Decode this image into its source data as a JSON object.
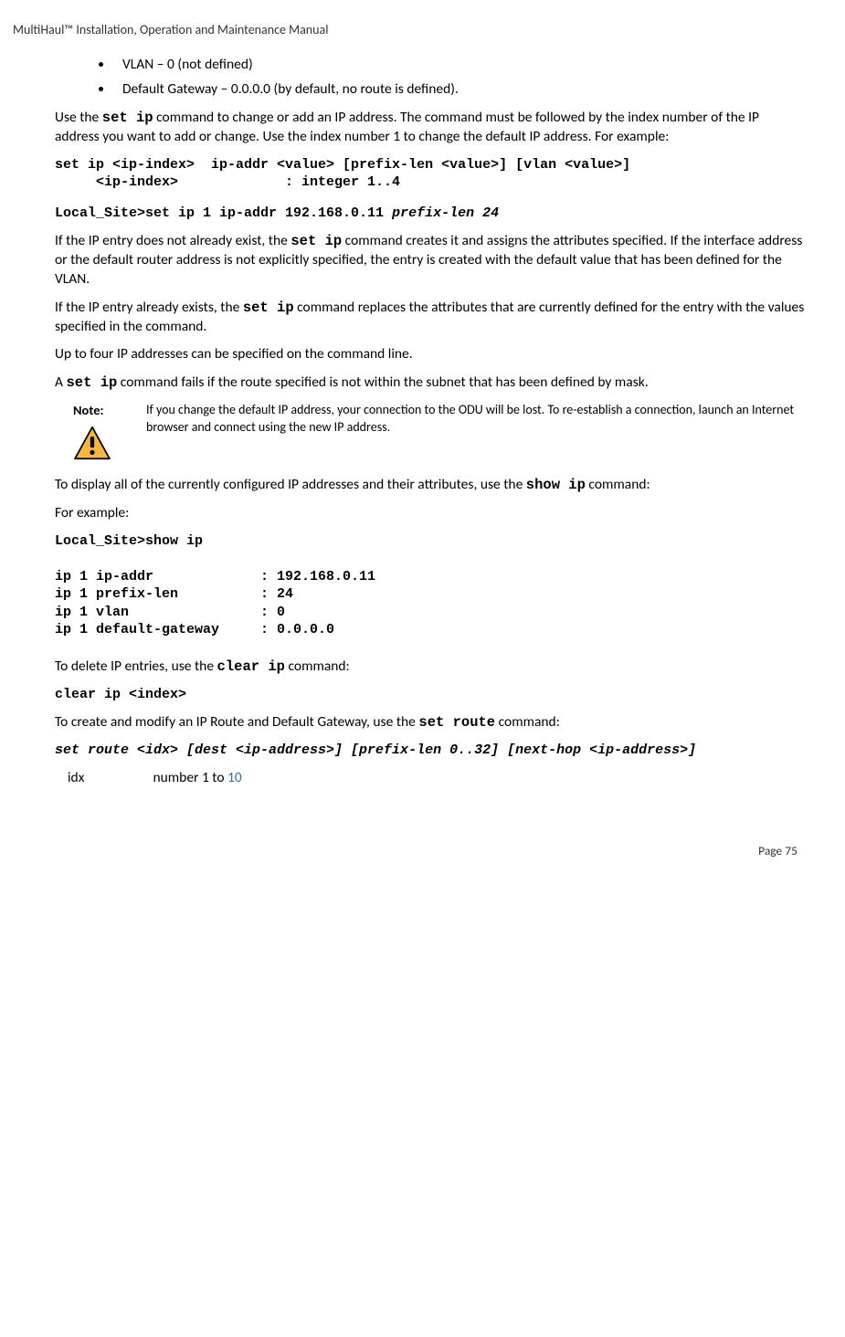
{
  "header": "MultiHaul™ Installation, Operation and Maintenance Manual",
  "bullets": [
    "VLAN – 0 (not defined)",
    "Default Gateway – 0.0.0.0 (by default, no route is defined)."
  ],
  "para1_pre": "Use the ",
  "para1_code": "set ip",
  "para1_post": " command to change or add an IP address. The command must be followed by the index number of the IP address you want to add or change. Use the index number 1 to change the default IP address. For example:",
  "codeblock1": "set ip <ip-index>  ip-addr <value> [prefix-len <value>] [vlan <value>]\n     <ip-index>             : integer 1..4",
  "codeblock2_plain": "Local_Site>set ip 1 ip-addr 192.168.0.11 ",
  "codeblock2_italic": "prefix-len 24",
  "para2_pre": "If the IP entry does not already exist, the ",
  "para2_code": "set ip",
  "para2_post": " command creates it and assigns the attributes specified. If the interface address or the default router address is not explicitly specified, the entry is created with the default value that has been defined for the VLAN.",
  "para3_pre": "If the IP entry already exists, the ",
  "para3_code": "set ip",
  "para3_post": " command replaces the attributes that are currently defined for the entry with the values specified in the command.",
  "para4": "Up to four IP addresses can be specified on the command line.",
  "para5_pre": "A ",
  "para5_code": "set ip",
  "para5_post": " command fails if the route specified is not within the subnet that has been defined by mask.",
  "note_label": "Note:",
  "note_body": "If you change the default IP address, your connection to the ODU will be lost. To re-establish a connection, launch an Internet browser and connect using the new IP address.",
  "para6_pre": "To display all of the currently configured IP addresses and their attributes, use the ",
  "para6_code": "show ip",
  "para6_post": " command:",
  "para7": "For example:",
  "codeblock3": "Local_Site>show ip\n\nip 1 ip-addr             : 192.168.0.11\nip 1 prefix-len          : 24\nip 1 vlan                : 0\nip 1 default-gateway     : 0.0.0.0",
  "para8_pre": "To delete IP entries, use the ",
  "para8_code": "clear ip",
  "para8_post": " command:",
  "codeblock4": "clear ip <index>",
  "para9_pre": "To create and modify an IP Route and Default Gateway, use the ",
  "para9_code": "set route",
  "para9_post": " command:",
  "codeblock5": "set route <idx> [dest <ip-address>] [prefix-len 0..32] [next-hop <ip-address>]",
  "idx_key": "idx",
  "idx_val_plain": "number 1 to ",
  "idx_val_blue": "10",
  "footer": "Page 75"
}
